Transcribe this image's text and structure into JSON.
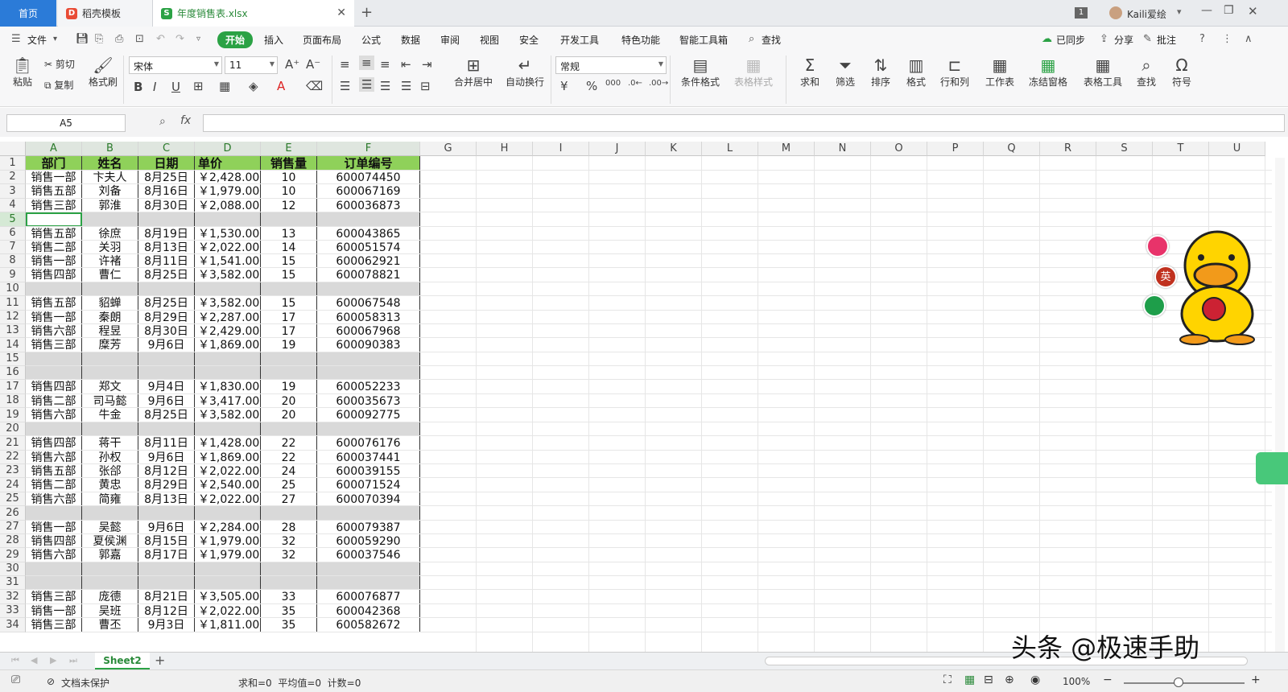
{
  "tabs": {
    "home": "首页",
    "template": "稻壳模板",
    "file": "年度销售表.xlsx"
  },
  "titlebar": {
    "badge": "1",
    "user": "Kaili爱绘"
  },
  "menu": {
    "file": "文件",
    "items": [
      "开始",
      "插入",
      "页面布局",
      "公式",
      "数据",
      "审阅",
      "视图",
      "安全",
      "开发工具",
      "特色功能",
      "智能工具箱"
    ],
    "search": "查找",
    "sync": "已同步",
    "share": "分享",
    "comment": "批注"
  },
  "ribbon": {
    "paste": "粘贴",
    "cut": "剪切",
    "copy": "复制",
    "format_painter": "格式刷",
    "font": "宋体",
    "size": "11",
    "number_format": "常规",
    "merge": "合并居中",
    "wrap": "自动换行",
    "cond_format": "条件格式",
    "table_style": "表格样式",
    "sum": "求和",
    "filter": "筛选",
    "sort": "排序",
    "format": "格式",
    "rows_cols": "行和列",
    "worksheet": "工作表",
    "freeze": "冻结窗格",
    "table_tools": "表格工具",
    "find": "查找",
    "symbol": "符号"
  },
  "formula_bar": {
    "name_box": "A5",
    "fx": "fx",
    "value": ""
  },
  "columns": [
    "A",
    "B",
    "C",
    "D",
    "E",
    "F",
    "G",
    "H",
    "I",
    "J",
    "K",
    "L",
    "M",
    "N",
    "O",
    "P",
    "Q",
    "R",
    "S",
    "T",
    "U"
  ],
  "table": {
    "headers": [
      "部门",
      "姓名",
      "日期",
      "单价",
      "销售量",
      "订单编号"
    ],
    "rows": [
      {
        "r": "1",
        "hdr": true
      },
      {
        "r": "2",
        "v": [
          "销售一部",
          "卞夫人",
          "8月25日",
          "￥2,428.00",
          "10",
          "600074450"
        ]
      },
      {
        "r": "3",
        "v": [
          "销售五部",
          "刘备",
          "8月16日",
          "￥1,979.00",
          "10",
          "600067169"
        ]
      },
      {
        "r": "4",
        "v": [
          "销售三部",
          "郭淮",
          "8月30日",
          "￥2,088.00",
          "12",
          "600036873"
        ]
      },
      {
        "r": "5",
        "blank": true
      },
      {
        "r": "6",
        "v": [
          "销售五部",
          "徐庶",
          "8月19日",
          "￥1,530.00",
          "13",
          "600043865"
        ]
      },
      {
        "r": "7",
        "v": [
          "销售二部",
          "关羽",
          "8月13日",
          "￥2,022.00",
          "14",
          "600051574"
        ]
      },
      {
        "r": "8",
        "v": [
          "销售一部",
          "许褚",
          "8月11日",
          "￥1,541.00",
          "15",
          "600062921"
        ]
      },
      {
        "r": "9",
        "v": [
          "销售四部",
          "曹仁",
          "8月25日",
          "￥3,582.00",
          "15",
          "600078821"
        ]
      },
      {
        "r": "10",
        "blank": true
      },
      {
        "r": "11",
        "v": [
          "销售五部",
          "貂蝉",
          "8月25日",
          "￥3,582.00",
          "15",
          "600067548"
        ]
      },
      {
        "r": "12",
        "v": [
          "销售一部",
          "秦朗",
          "8月29日",
          "￥2,287.00",
          "17",
          "600058313"
        ]
      },
      {
        "r": "13",
        "v": [
          "销售六部",
          "程昱",
          "8月30日",
          "￥2,429.00",
          "17",
          "600067968"
        ]
      },
      {
        "r": "14",
        "v": [
          "销售三部",
          "糜芳",
          "9月6日",
          "￥1,869.00",
          "19",
          "600090383"
        ]
      },
      {
        "r": "15",
        "blank": true
      },
      {
        "r": "16",
        "blank": true
      },
      {
        "r": "17",
        "v": [
          "销售四部",
          "郑文",
          "9月4日",
          "￥1,830.00",
          "19",
          "600052233"
        ]
      },
      {
        "r": "18",
        "v": [
          "销售二部",
          "司马懿",
          "9月6日",
          "￥3,417.00",
          "20",
          "600035673"
        ]
      },
      {
        "r": "19",
        "v": [
          "销售六部",
          "牛金",
          "8月25日",
          "￥3,582.00",
          "20",
          "600092775"
        ]
      },
      {
        "r": "20",
        "blank": true
      },
      {
        "r": "21",
        "v": [
          "销售四部",
          "蒋干",
          "8月11日",
          "￥1,428.00",
          "22",
          "600076176"
        ]
      },
      {
        "r": "22",
        "v": [
          "销售六部",
          "孙权",
          "9月6日",
          "￥1,869.00",
          "22",
          "600037441"
        ]
      },
      {
        "r": "23",
        "v": [
          "销售五部",
          "张郃",
          "8月12日",
          "￥2,022.00",
          "24",
          "600039155"
        ]
      },
      {
        "r": "24",
        "v": [
          "销售二部",
          "黄忠",
          "8月29日",
          "￥2,540.00",
          "25",
          "600071524"
        ]
      },
      {
        "r": "25",
        "v": [
          "销售六部",
          "简雍",
          "8月13日",
          "￥2,022.00",
          "27",
          "600070394"
        ]
      },
      {
        "r": "26",
        "blank": true
      },
      {
        "r": "27",
        "v": [
          "销售一部",
          "吴懿",
          "9月6日",
          "￥2,284.00",
          "28",
          "600079387"
        ]
      },
      {
        "r": "28",
        "v": [
          "销售四部",
          "夏侯渊",
          "8月15日",
          "￥1,979.00",
          "32",
          "600059290"
        ]
      },
      {
        "r": "29",
        "v": [
          "销售六部",
          "郭嘉",
          "8月17日",
          "￥1,979.00",
          "32",
          "600037546"
        ]
      },
      {
        "r": "30",
        "blank": true
      },
      {
        "r": "31",
        "blank": true
      },
      {
        "r": "32",
        "v": [
          "销售三部",
          "庞德",
          "8月21日",
          "￥3,505.00",
          "33",
          "600076877"
        ]
      },
      {
        "r": "33",
        "v": [
          "销售一部",
          "吴班",
          "8月12日",
          "￥2,022.00",
          "35",
          "600042368"
        ]
      },
      {
        "r": "34",
        "v": [
          "销售三部",
          "曹丕",
          "9月3日",
          "￥1,811.00",
          "35",
          "600582672"
        ]
      }
    ]
  },
  "sheet_tab": "Sheet2",
  "status": {
    "protect": "文档未保护",
    "stats": "求和=0  平均值=0  计数=0",
    "zoom": "100%"
  },
  "watermark": "头条 @极速手助",
  "float_icons": {
    "ime": "英"
  },
  "colors": {
    "header_green": "#8fd15a",
    "accent_green": "#2ba245",
    "home_blue": "#2b7bd8"
  }
}
